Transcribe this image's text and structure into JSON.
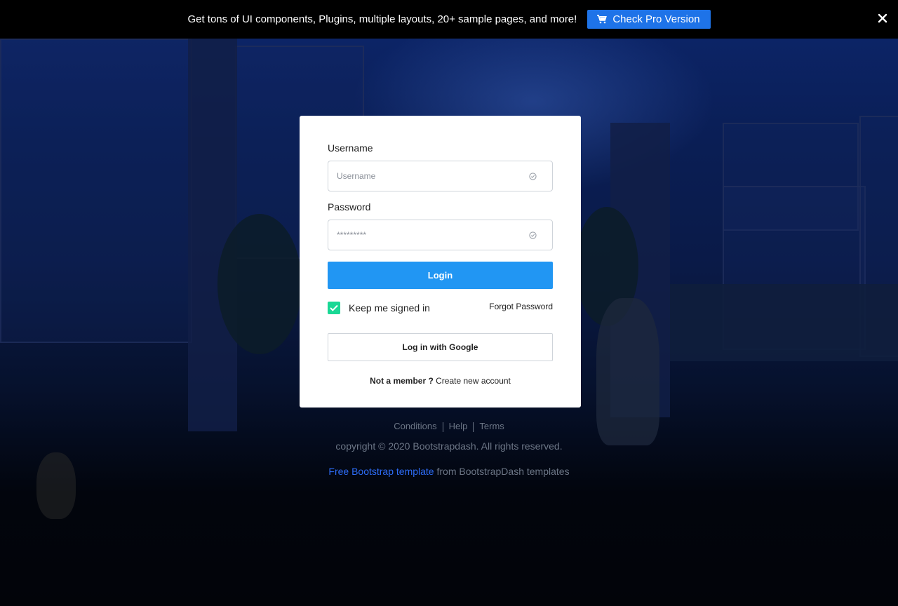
{
  "banner": {
    "text": "Get tons of UI components, Plugins, multiple layouts, 20+ sample pages, and more!",
    "pro_label": "Check Pro Version",
    "icons": {
      "cart": "cart-icon",
      "close": "close-icon"
    }
  },
  "login": {
    "username_label": "Username",
    "username_placeholder": "Username",
    "password_label": "Password",
    "password_placeholder": "*********",
    "login_button": "Login",
    "keep_signed_in": "Keep me signed in",
    "keep_checked": true,
    "forgot_password": "Forgot Password",
    "google_button": "Log in with Google",
    "not_member": "Not a member ?",
    "create_account": "Create new account",
    "accent_color": "#2196f3",
    "check_color": "#19d895"
  },
  "footer": {
    "links": [
      "Conditions",
      "Help",
      "Terms"
    ],
    "copyright": "copyright © 2020 Bootstrapdash. All rights reserved.",
    "credit_link": "Free Bootstrap template",
    "credit_rest": " from BootstrapDash templates"
  }
}
